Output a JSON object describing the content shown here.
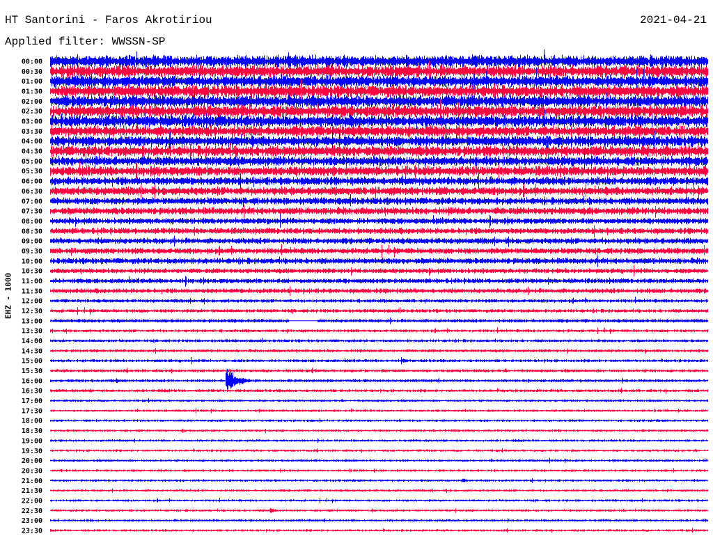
{
  "header": {
    "title": "HT Santorini - Faros Akrotiriou",
    "date": "2021-04-21",
    "filter": "Applied filter: WWSSN-SP",
    "channel": "EHZ - 1000"
  },
  "chart_data": {
    "type": "line",
    "title": "HT Santorini - Faros Akrotiriou",
    "subtitle": "Applied filter: WWSSN-SP",
    "ylabel": "EHZ - 1000",
    "minutes_per_line": 30,
    "colors": [
      "#0000ff",
      "#ff0040"
    ],
    "row_labels": [
      "00:00",
      "00:30",
      "01:00",
      "01:30",
      "02:00",
      "02:30",
      "03:00",
      "03:30",
      "04:00",
      "04:30",
      "05:00",
      "05:30",
      "06:00",
      "06:30",
      "07:00",
      "07:30",
      "08:00",
      "08:30",
      "09:00",
      "09:30",
      "10:00",
      "10:30",
      "11:00",
      "11:30",
      "12:00",
      "12:30",
      "13:00",
      "13:30",
      "14:00",
      "14:30",
      "15:00",
      "15:30",
      "16:00",
      "16:30",
      "17:00",
      "17:30",
      "18:00",
      "18:30",
      "19:00",
      "19:30",
      "20:00",
      "20:30",
      "21:00",
      "21:30",
      "22:00",
      "22:30",
      "23:00",
      "23:30"
    ],
    "relative_amplitude": [
      10,
      10,
      10,
      10,
      10,
      10,
      10,
      9,
      9,
      9,
      8,
      8,
      7,
      7,
      6,
      6,
      5,
      5,
      5,
      5,
      5,
      4,
      4,
      4,
      3,
      3,
      3,
      2.5,
      2.5,
      2.5,
      2.5,
      2.5,
      2.5,
      2.5,
      2,
      2,
      2,
      2,
      2,
      2,
      2,
      2,
      2,
      2,
      2,
      2,
      2,
      2
    ],
    "events": [
      {
        "row": "13:00",
        "minute_start": 10.9,
        "minute_end": 12.2,
        "type": "gap"
      },
      {
        "row": "15:00",
        "minute_start": 16.0,
        "minute_end": 16.8,
        "amplitude": 6
      },
      {
        "row": "16:00",
        "minute_start": 3.0,
        "minute_end": 3.6,
        "amplitude": 5
      },
      {
        "row": "16:00",
        "minute_start": 8.0,
        "minute_end": 9.5,
        "amplitude": 26
      },
      {
        "row": "21:00",
        "minute_start": 18.8,
        "minute_end": 20.1,
        "amplitude": 4
      },
      {
        "row": "22:30",
        "minute_start": 10.0,
        "minute_end": 10.8,
        "amplitude": 6
      }
    ]
  }
}
